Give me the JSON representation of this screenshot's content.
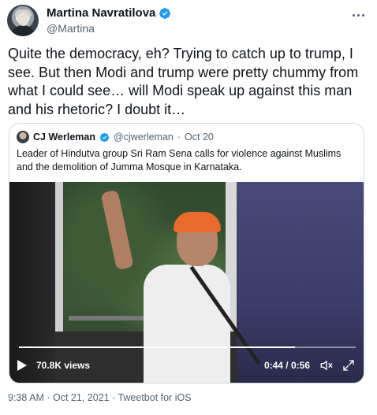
{
  "tweet": {
    "author": {
      "display_name": "Martina Navratilova",
      "handle": "@Martina",
      "verified": true
    },
    "text": "Quite the democracy, eh? Trying to catch up to trump, I see. But then Modi and trump were pretty chummy from what I could see… will Modi speak up against this man and his rhetoric? I doubt it…",
    "timestamp": "9:38 AM · Oct 21, 2021",
    "separator": " · ",
    "source": "Tweetbot for iOS"
  },
  "quote": {
    "author": {
      "display_name": "CJ Werleman",
      "handle": "@cjwerleman",
      "verified": true
    },
    "dot": "·",
    "date": "Oct 20",
    "text": "Leader of Hindutva group Sri Ram Sena calls for violence against Muslims and the demolition of Jumma Mosque in Karnataka.",
    "video": {
      "views": "70.8K views",
      "time": "0:44 / 0:56",
      "progress": 0.82
    }
  },
  "colors": {
    "verified": "#1d9bf0",
    "secondary_text": "#536471",
    "border": "#cfd9de"
  },
  "icons": {
    "verified": "verified-badge-icon",
    "more": "more-icon",
    "play": "play-icon",
    "volume": "volume-icon",
    "fullscreen": "fullscreen-icon"
  }
}
